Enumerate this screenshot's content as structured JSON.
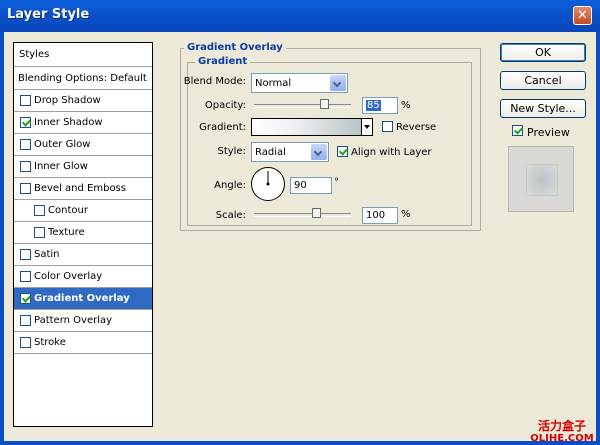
{
  "window": {
    "title": "Layer Style",
    "close_glyph": "✕"
  },
  "styles_list": {
    "header": "Styles",
    "blending": "Blending Options: Default",
    "items": [
      {
        "label": "Drop Shadow",
        "checked": false
      },
      {
        "label": "Inner Shadow",
        "checked": true
      },
      {
        "label": "Outer Glow",
        "checked": false
      },
      {
        "label": "Inner Glow",
        "checked": false
      },
      {
        "label": "Bevel and Emboss",
        "checked": false
      },
      {
        "label": "Contour",
        "checked": false
      },
      {
        "label": "Texture",
        "checked": false
      },
      {
        "label": "Satin",
        "checked": false
      },
      {
        "label": "Color Overlay",
        "checked": false
      },
      {
        "label": "Gradient Overlay",
        "checked": true,
        "selected": true
      },
      {
        "label": "Pattern Overlay",
        "checked": false
      },
      {
        "label": "Stroke",
        "checked": false
      }
    ]
  },
  "gradient_overlay": {
    "title": "Gradient Overlay",
    "subtitle": "Gradient",
    "blend_mode": {
      "label": "Blend Mode:",
      "value": "Normal"
    },
    "opacity": {
      "label": "Opacity:",
      "value": "85",
      "unit": "%",
      "level": 85
    },
    "gradient": {
      "label": "Gradient:",
      "reverse_label": "Reverse",
      "reverse_checked": false
    },
    "style": {
      "label": "Style:",
      "value": "Radial",
      "align_label": "Align with Layer",
      "align_checked": true
    },
    "angle": {
      "label": "Angle:",
      "value": "90",
      "unit": "°",
      "degrees": 90
    },
    "scale": {
      "label": "Scale:",
      "value": "100",
      "unit": "%",
      "level": 100
    }
  },
  "buttons": {
    "ok": "OK",
    "cancel": "Cancel",
    "new_style": "New Style...",
    "preview_label": "Preview",
    "preview_checked": true
  },
  "watermark": {
    "cn": "活力盒子",
    "en": "OLIHE.COM"
  },
  "colors": {
    "title_bar": "#0a4fc6",
    "selected_row": "#316ac5",
    "group_title": "#0a3ca4",
    "close_button": "#c24a22"
  }
}
